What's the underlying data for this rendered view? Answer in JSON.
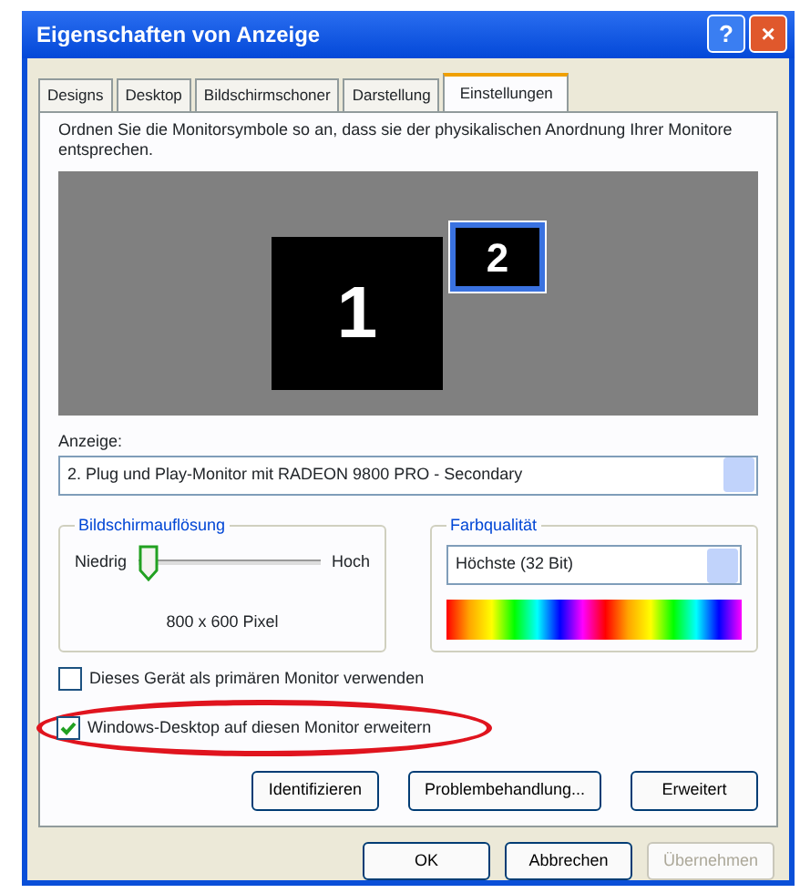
{
  "window": {
    "title": "Eigenschaften von Anzeige",
    "help_button": "?",
    "close_button": "×"
  },
  "tabs": [
    {
      "label": "Designs",
      "selected": false
    },
    {
      "label": "Desktop",
      "selected": false
    },
    {
      "label": "Bildschirmschoner",
      "selected": false
    },
    {
      "label": "Darstellung",
      "selected": false
    },
    {
      "label": "Einstellungen",
      "selected": true
    }
  ],
  "instruction": "Ordnen Sie die Monitorsymbole so an, dass sie der physikalischen Anordnung Ihrer Monitore entsprechen.",
  "monitors": [
    {
      "label": "1",
      "selected": false
    },
    {
      "label": "2",
      "selected": true
    }
  ],
  "display": {
    "label": "Anzeige:",
    "value": "2. Plug und Play-Monitor mit RADEON 9800 PRO - Secondary"
  },
  "resolution": {
    "title": "Bildschirmauflösung",
    "low": "Niedrig",
    "high": "Hoch",
    "level": 0,
    "reading": "800 x 600 Pixel"
  },
  "color_quality": {
    "title": "Farbqualität",
    "value": "Höchste (32 Bit)"
  },
  "checkboxes": [
    {
      "label": "Dieses Gerät als primären Monitor verwenden",
      "checked": false
    },
    {
      "label": "Windows-Desktop auf diesen Monitor erweitern",
      "checked": true
    }
  ],
  "panel_buttons": [
    {
      "label": "Identifizieren",
      "disabled": false
    },
    {
      "label": "Problembehandlung...",
      "disabled": false
    },
    {
      "label": "Erweitert",
      "disabled": false
    }
  ],
  "dialog_buttons": [
    {
      "label": "OK",
      "disabled": false
    },
    {
      "label": "Abbrechen",
      "disabled": false
    },
    {
      "label": "Übernehmen",
      "disabled": true
    }
  ]
}
